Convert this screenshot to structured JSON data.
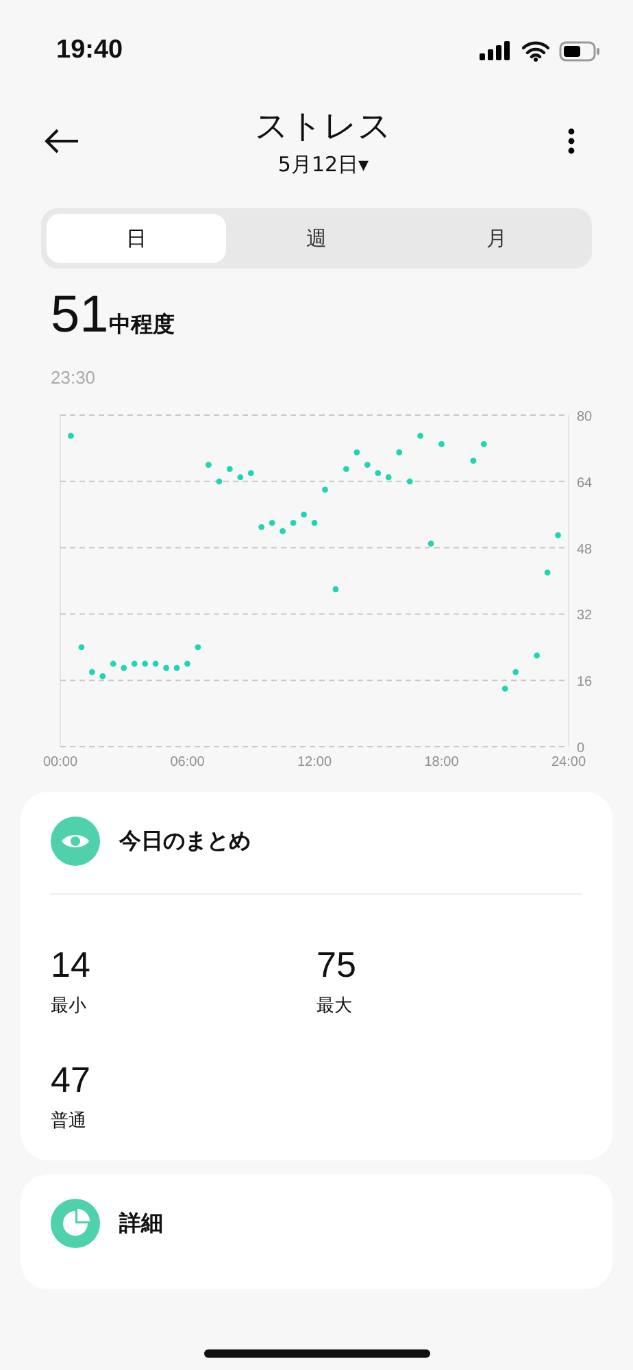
{
  "status_bar": {
    "time": "19:40"
  },
  "header": {
    "title": "ストレス",
    "date": "5月12日▾"
  },
  "tabs": [
    {
      "label": "日",
      "selected": true
    },
    {
      "label": "週",
      "selected": false
    },
    {
      "label": "月",
      "selected": false
    }
  ],
  "current": {
    "value": "51",
    "level_label": "中程度",
    "time": "23:30"
  },
  "chart_data": {
    "type": "scatter",
    "grid": true,
    "xlim": [
      0,
      24
    ],
    "ylim": [
      0,
      80
    ],
    "xticks": [
      {
        "value": 0,
        "label": "00:00"
      },
      {
        "value": 6,
        "label": "06:00"
      },
      {
        "value": 12,
        "label": "12:00"
      },
      {
        "value": 18,
        "label": "18:00"
      },
      {
        "value": 24,
        "label": "24:00"
      }
    ],
    "yticks": [
      0,
      16,
      32,
      48,
      64,
      80
    ],
    "series": [
      {
        "color": "#1ed6b4",
        "x": [
          0.5,
          1,
          1.5,
          2,
          2.5,
          3,
          3.5,
          4,
          4.5,
          5,
          5.5,
          6,
          6.5,
          7,
          7.5,
          8,
          8.5,
          9,
          9.5,
          10,
          10.5,
          11,
          11.5,
          12,
          12.5,
          13,
          13.5,
          14,
          14.5,
          15,
          15.5,
          16,
          16.5,
          17,
          17.5,
          18,
          19.5,
          20,
          21,
          21.5,
          22.5,
          23,
          23.5
        ],
        "values": [
          75,
          24,
          18,
          17,
          20,
          19,
          20,
          20,
          20,
          19,
          19,
          20,
          24,
          68,
          64,
          67,
          65,
          66,
          53,
          54,
          52,
          54,
          56,
          54,
          62,
          38,
          67,
          71,
          68,
          66,
          65,
          71,
          64,
          75,
          49,
          73,
          69,
          73,
          14,
          18,
          22,
          42,
          51
        ]
      }
    ]
  },
  "summary": {
    "title": "今日のまとめ",
    "stats": [
      {
        "value": "14",
        "label": "最小"
      },
      {
        "value": "75",
        "label": "最大"
      },
      {
        "value": "47",
        "label": "普通"
      }
    ]
  },
  "details": {
    "title": "詳細"
  }
}
